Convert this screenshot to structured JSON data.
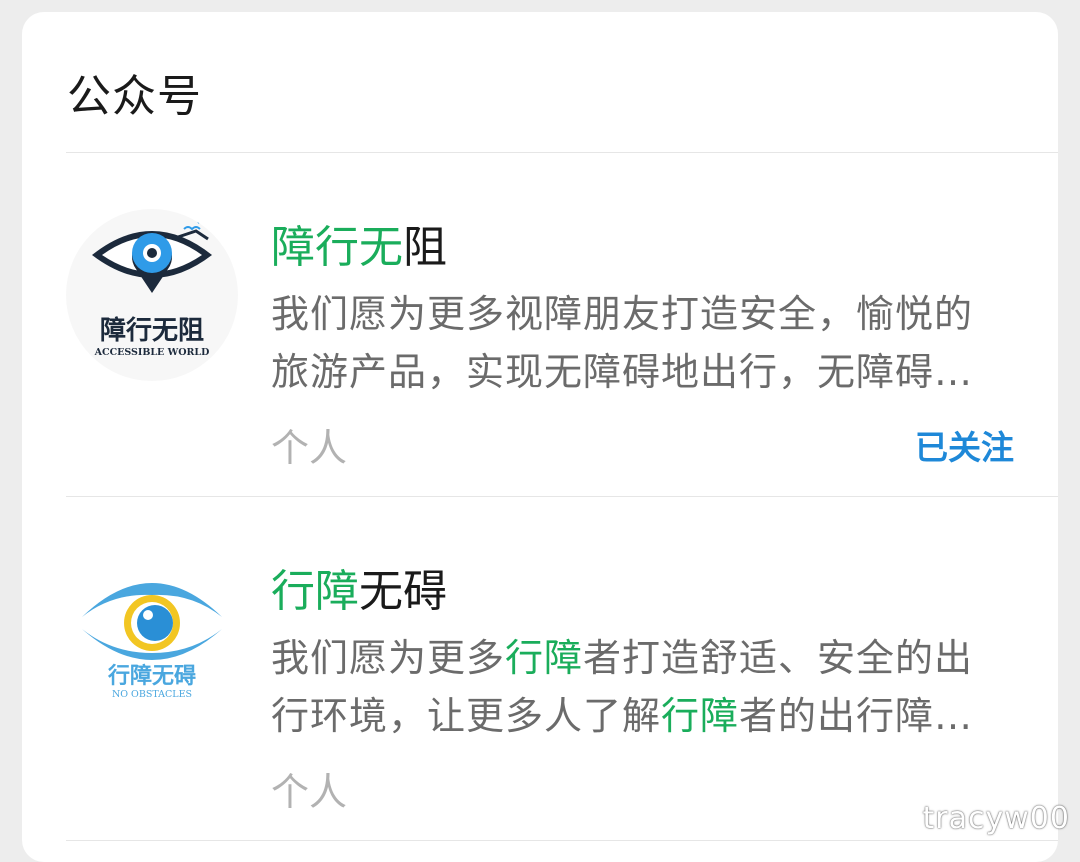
{
  "section": {
    "title": "公众号"
  },
  "results": [
    {
      "name_hl": "障行无",
      "name_rest": "阻",
      "desc_line1": "我们愿为更多视障朋友打造安全，愉悦的",
      "desc_line2": "旅游产品，实现无障碍地出行，无障碍…",
      "type": "个人",
      "follow_status": "已关注",
      "logo_text": "障行无阻",
      "logo_subtext": "ACCESSIBLE WORLD"
    },
    {
      "name_hl": "行障",
      "name_rest": "无碍",
      "desc_line1_a": "我们愿为更多",
      "desc_line1_hl": "行障",
      "desc_line1_b": "者打造舒适、安全的出",
      "desc_line2_a": "行环境，让更多人了解",
      "desc_line2_hl": "行障",
      "desc_line2_b": "者的出行障…",
      "type": "个人",
      "logo_text": "行障无碍",
      "logo_subtext": "NO OBSTACLES"
    }
  ],
  "watermark": "tracyw00",
  "colors": {
    "highlight": "#1aad5b",
    "follow": "#1e88d8",
    "logo1_blue": "#2f9be8",
    "logo1_navy": "#1c2a3c",
    "logo2_blue": "#4aa7df",
    "logo2_gold": "#f2c623"
  }
}
